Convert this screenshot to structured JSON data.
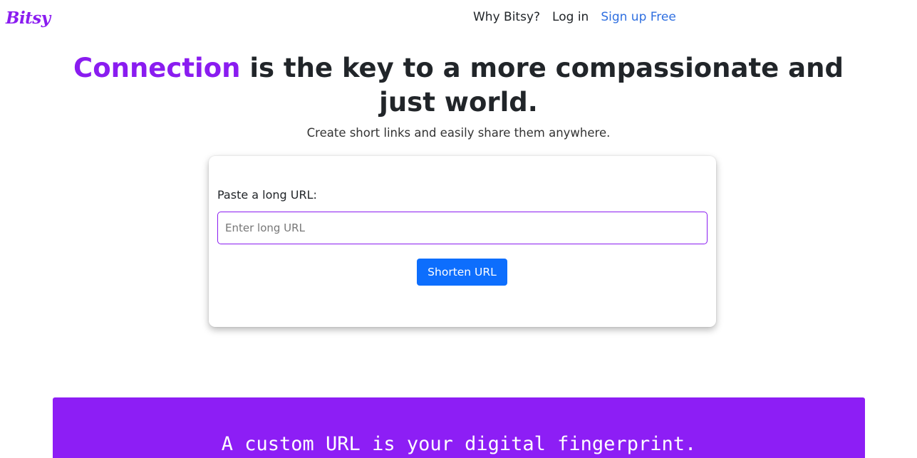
{
  "header": {
    "logo": "Bitsy",
    "nav": {
      "why": "Why Bitsy?",
      "login": "Log in",
      "signup": "Sign up Free"
    }
  },
  "hero": {
    "title_accent": "Connection",
    "title_rest": " is the key to a more compassionate and just world.",
    "subtitle": "Create short links and easily share them anywhere."
  },
  "form": {
    "label": "Paste a long URL:",
    "input_value": "",
    "input_placeholder": "Enter long URL",
    "button_label": "Shorten URL"
  },
  "banner": {
    "text": "A custom URL is your digital fingerprint."
  },
  "colors": {
    "brand_purple": "#8a1cf0",
    "banner_purple": "#8d1ef5",
    "primary_blue": "#0d6efd",
    "link_blue": "#2f6fe0"
  }
}
